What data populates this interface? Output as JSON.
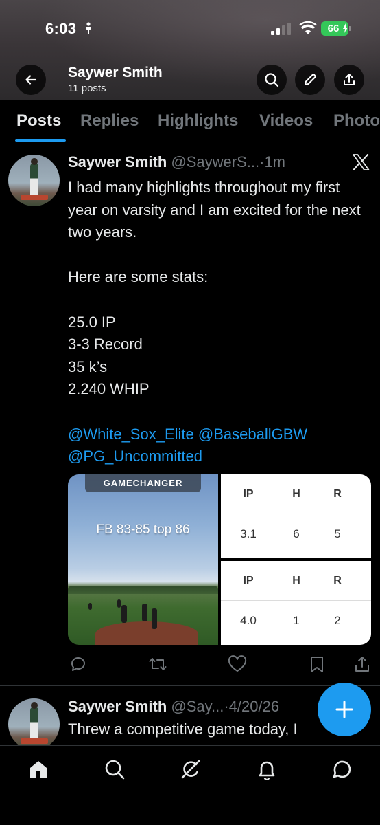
{
  "status_bar": {
    "time": "6:03",
    "battery": "66"
  },
  "profile_header": {
    "name": "Saywer Smith",
    "post_count": "11 posts"
  },
  "tabs": [
    {
      "label": "Posts",
      "active": true
    },
    {
      "label": "Replies",
      "active": false
    },
    {
      "label": "Highlights",
      "active": false
    },
    {
      "label": "Videos",
      "active": false
    },
    {
      "label": "Photo",
      "active": false
    }
  ],
  "post": {
    "author": "Saywer Smith",
    "handle": "@SaywerS...",
    "separator": "·",
    "time": "1m",
    "text": "I had many highlights throughout my first year on varsity and I am excited for the next two years.\n\nHere are some stats:\n\n25.0 IP\n3-3 Record\n35 k’s\n2.240 WHIP\n\n",
    "mentions": [
      "@White_Sox_Elite",
      "@BaseballGBW",
      "@PG_Uncommitted"
    ],
    "media": {
      "video_banner": "GAMECHANGER",
      "video_caption": "FB 83-85 top 86",
      "stat_tables": [
        {
          "headers": [
            "IP",
            "H",
            "R"
          ],
          "values": [
            "3.1",
            "6",
            "5"
          ]
        },
        {
          "headers": [
            "IP",
            "H",
            "R"
          ],
          "values": [
            "4.0",
            "1",
            "2"
          ]
        }
      ]
    }
  },
  "post2": {
    "author": "Saywer Smith",
    "handle": "@Say...",
    "separator": "·",
    "time": "4/20/26",
    "text": "Threw a competitive game today, I"
  },
  "colors": {
    "accent": "#1d9bf0",
    "battery": "#34c759",
    "muted": "#71767b"
  },
  "icons": {
    "back": "arrow-left-icon",
    "search": "search-icon",
    "edit": "pencil-icon",
    "share": "share-icon",
    "brand": "x-logo-icon",
    "nav": [
      "home-icon",
      "search-icon",
      "grok-icon",
      "bell-icon",
      "message-icon"
    ]
  }
}
